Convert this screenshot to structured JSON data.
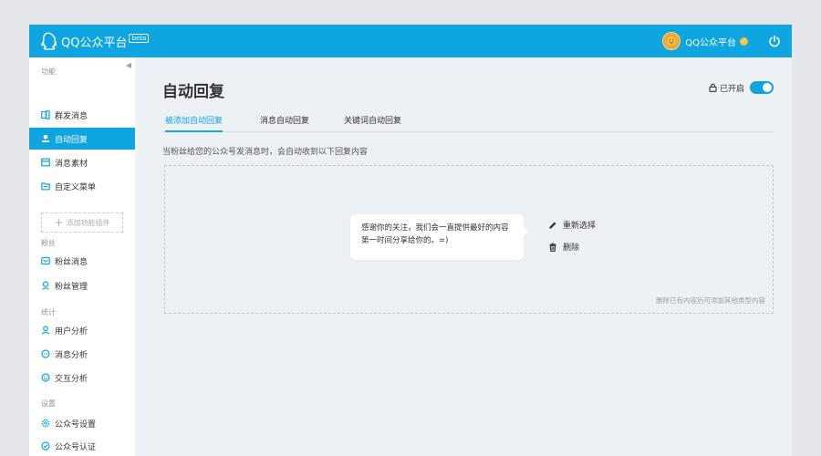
{
  "topbar": {
    "app_title": "QQ公众平台",
    "beta_badge": "beta",
    "account_name": "QQ公众平台"
  },
  "sidebar": {
    "sections": [
      {
        "label": "功能",
        "items": [
          "群发消息",
          "自动回复",
          "消息素材",
          "自定义菜单"
        ]
      },
      {
        "label": "粉丝",
        "items": [
          "粉丝消息",
          "粉丝管理"
        ]
      },
      {
        "label": "统计",
        "items": [
          "用户分析",
          "消息分析",
          "交互分析"
        ]
      },
      {
        "label": "设置",
        "items": [
          "公众号设置",
          "公众号认证"
        ]
      }
    ],
    "active_item": "自动回复",
    "add_plugin_label": "添加功能插件"
  },
  "main": {
    "title": "自动回复",
    "toggle_label": "已开启",
    "toggle_on": true,
    "tabs": [
      "被添加自动回复",
      "消息自动回复",
      "关键词自动回复"
    ],
    "active_tab": "被添加自动回复",
    "hint": "当粉丝给您的公众号发消息时，会自动收到以下回复内容",
    "reply_text": "感谢你的关注，我们会一直提供最好的内容第一时间分享给你的。=)",
    "actions": {
      "reselect": "重新选择",
      "delete": "删除"
    },
    "box_note": "删除已有内容后可添加其他类型内容"
  },
  "colors": {
    "accent": "#0ea5e0",
    "background": "#edf0f5",
    "sidebar_bg": "#ffffff"
  },
  "icons": {
    "logo": "qq-penguin-icon",
    "power": "power-icon",
    "lock": "lock-icon",
    "edit": "pencil-icon",
    "delete": "trash-icon"
  }
}
